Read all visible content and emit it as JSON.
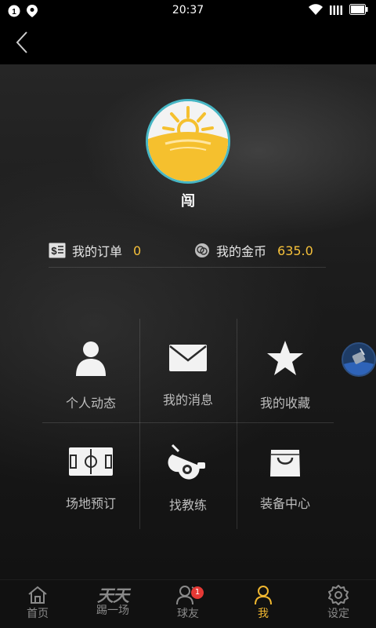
{
  "status_bar": {
    "time": "20:37",
    "left_icons": [
      "notification-1-icon",
      "location-icon"
    ],
    "right_icons": [
      "wifi-icon",
      "signal-icon",
      "battery-icon"
    ]
  },
  "header": {
    "back_icon": "chevron-left-icon"
  },
  "profile": {
    "username": "闯",
    "avatar_color": "#f5c02e",
    "avatar_border": "#47b6c4"
  },
  "stats": {
    "orders": {
      "label": "我的订单",
      "value": "0",
      "icon": "receipt-icon"
    },
    "coins": {
      "label": "我的金币",
      "value": "635.0",
      "icon": "coin-icon"
    },
    "value_color": "#f5c03a"
  },
  "menu": [
    {
      "label": "个人动态",
      "icon": "person-icon"
    },
    {
      "label": "我的消息",
      "icon": "envelope-icon"
    },
    {
      "label": "我的收藏",
      "icon": "star-icon"
    },
    {
      "label": "场地预订",
      "icon": "soccer-field-icon"
    },
    {
      "label": "找教练",
      "icon": "whistle-icon"
    },
    {
      "label": "装备中心",
      "icon": "shopping-bag-icon"
    }
  ],
  "tabs": [
    {
      "label": "首页",
      "icon": "home-icon",
      "active": false
    },
    {
      "label": "踢一场",
      "logo_text": "天天",
      "active": false
    },
    {
      "label": "球友",
      "icon": "friends-icon",
      "badge": "1",
      "active": false
    },
    {
      "label": "我",
      "icon": "user-icon",
      "active": true
    },
    {
      "label": "设定",
      "icon": "gear-icon",
      "active": false
    }
  ],
  "accent_color": "#f0b730"
}
